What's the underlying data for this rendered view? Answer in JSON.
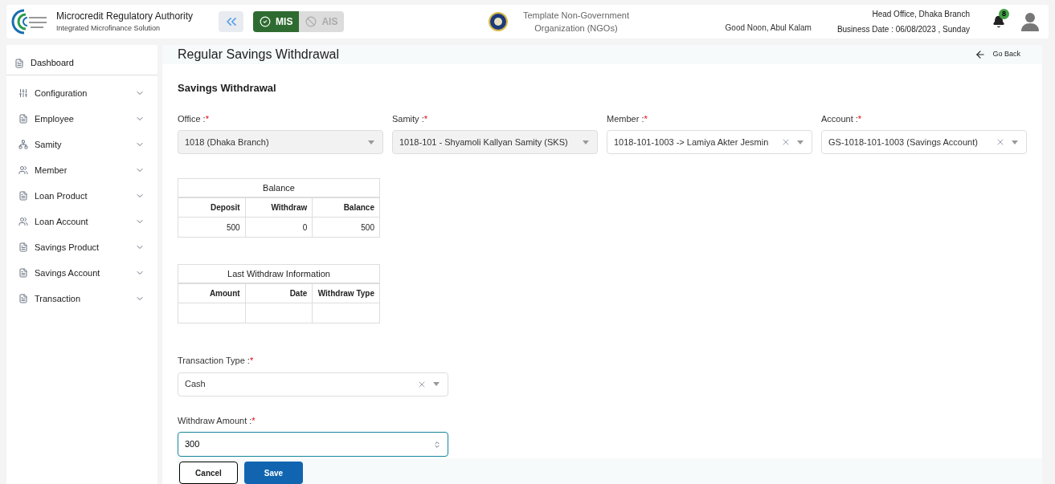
{
  "header": {
    "org_name": "Microcredit Regulatory Authority",
    "org_subtitle": "Integrated Microfinance Solution",
    "modules": [
      {
        "label": "MIS",
        "selected": true
      },
      {
        "label": "AIS",
        "selected": false
      }
    ],
    "ngo_name": "Template Non-Government Organization (NGOs)",
    "greeting": "Good Noon, Abul Kalam",
    "branch": "Head Office, Dhaka Branch",
    "business_date": "Business Date : 06/08/2023 , Sunday",
    "notification_count": "8"
  },
  "sidebar": {
    "items": [
      {
        "label": "Dashboard",
        "kind": "link"
      },
      {
        "label": "Configuration",
        "kind": "group",
        "expanded": false
      },
      {
        "label": "Employee",
        "kind": "group",
        "expanded": false
      },
      {
        "label": "Samity",
        "kind": "group",
        "expanded": false
      },
      {
        "label": "Member",
        "kind": "group",
        "expanded": false
      },
      {
        "label": "Loan Product",
        "kind": "group",
        "expanded": false
      },
      {
        "label": "Loan Account",
        "kind": "group",
        "expanded": false
      },
      {
        "label": "Savings Product",
        "kind": "group",
        "expanded": false
      },
      {
        "label": "Savings Account",
        "kind": "group",
        "expanded": false
      },
      {
        "label": "Transaction",
        "kind": "group",
        "expanded": false
      }
    ]
  },
  "page": {
    "title": "Regular Savings Withdrawal",
    "go_back": "Go Back",
    "section_title": "Savings Withdrawal",
    "selects": [
      {
        "label": "Office :",
        "required_mark": "*",
        "value": "1018 (Dhaka Branch)",
        "disabled": true,
        "clearable": false
      },
      {
        "label": "Samity :",
        "required_mark": "*",
        "value": "1018-101 - Shyamoli Kallyan Samity (SKS)",
        "disabled": true,
        "clearable": false
      },
      {
        "label": "Member :",
        "required_mark": "*",
        "value": "1018-101-1003 -> Lamiya Akter Jesmin",
        "disabled": false,
        "clearable": true
      },
      {
        "label": "Account :",
        "required_mark": "*",
        "value": "GS-1018-101-1003 (Savings Account)",
        "disabled": false,
        "clearable": true
      }
    ],
    "balance_table": {
      "title": "Balance",
      "columns": [
        "Deposit",
        "Withdraw",
        "Balance"
      ],
      "rows": [
        [
          "500",
          "0",
          "500"
        ]
      ]
    },
    "last_withdraw_table": {
      "title": "Last Withdraw Information",
      "columns": [
        "Amount",
        "Date",
        "Withdraw Type"
      ],
      "rows": [
        [
          "",
          "",
          ""
        ]
      ]
    },
    "transaction_type": {
      "label": "Transaction Type :",
      "required_mark": "*",
      "value": "Cash",
      "disabled": false,
      "clearable": true
    },
    "withdraw_amount": {
      "label": "Withdraw Amount :",
      "required_mark": "*",
      "value": "300",
      "focused": true
    },
    "buttons": [
      {
        "label": "Cancel",
        "kind": "secondary"
      },
      {
        "label": "Save",
        "kind": "primary"
      }
    ]
  }
}
